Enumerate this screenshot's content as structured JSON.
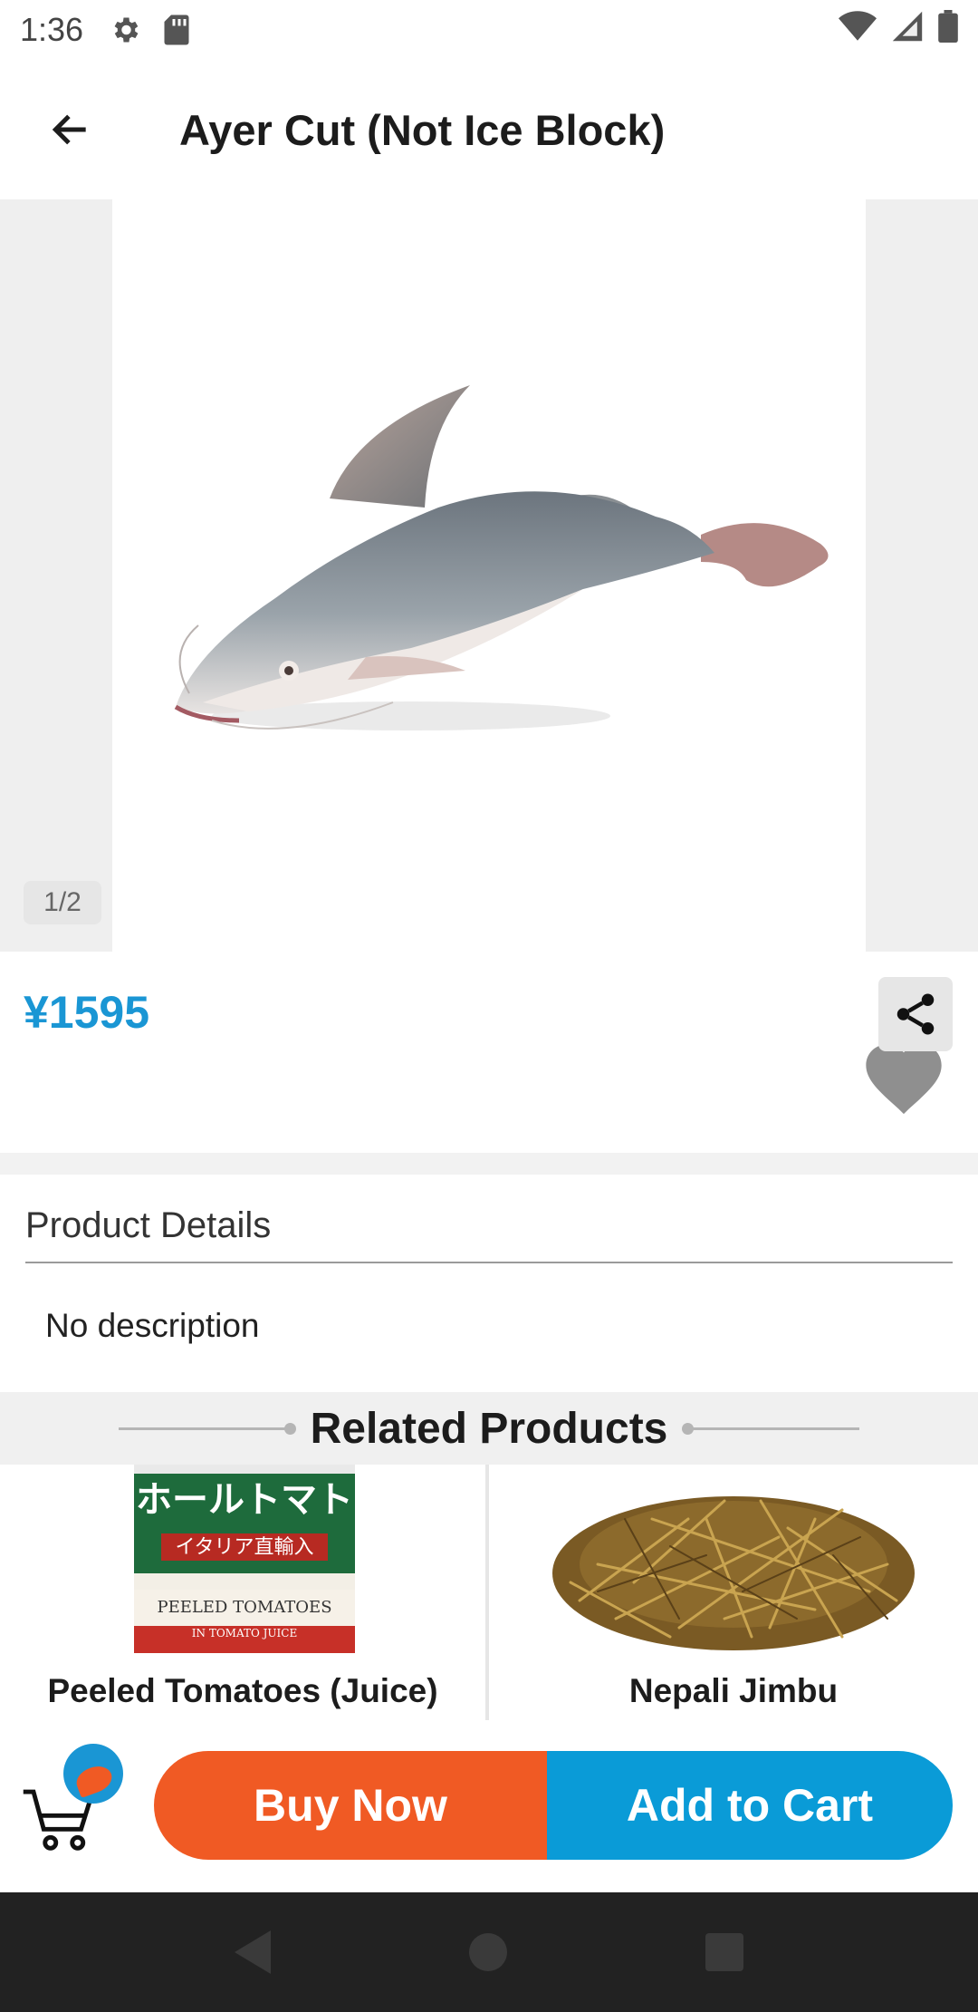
{
  "status_bar": {
    "time": "1:36"
  },
  "toolbar": {
    "title": "Ayer Cut (Not Ice Block)"
  },
  "gallery": {
    "counter": "1/2"
  },
  "product": {
    "price": "¥1595"
  },
  "details": {
    "heading": "Product Details",
    "description": "No description"
  },
  "related": {
    "heading": "Related Products",
    "items": [
      {
        "name": "Peeled Tomatoes (Juice)",
        "can_text_top": "ホールトマト",
        "can_text_mid": "イタリア直輸入",
        "can_text_bottom": "PEELED TOMATOES",
        "can_text_small": "IN TOMATO JUICE"
      },
      {
        "name": "Nepali Jimbu"
      }
    ]
  },
  "actions": {
    "buy_now": "Buy Now",
    "add_to_cart": "Add to Cart"
  },
  "colors": {
    "accent_blue": "#1a96d4",
    "buy_orange": "#f05a24",
    "cart_blue": "#0a9bd7"
  },
  "icons": [
    "gear-icon",
    "sd-card-icon",
    "wifi-icon",
    "signal-icon",
    "battery-icon",
    "back-arrow-icon",
    "heart-icon",
    "share-icon",
    "cart-icon"
  ]
}
